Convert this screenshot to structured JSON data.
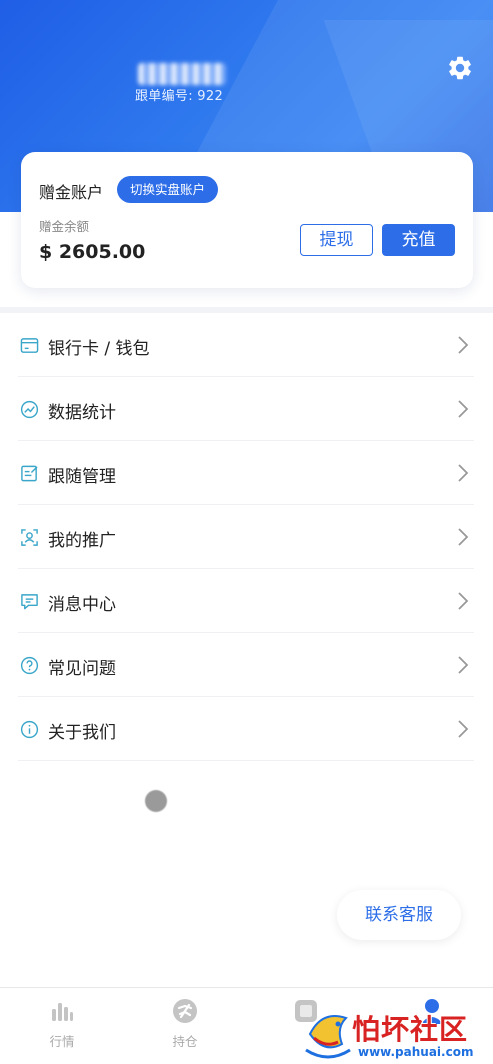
{
  "header": {
    "follow_number": "跟单编号: 922",
    "settings_icon": "gear-icon"
  },
  "account": {
    "title": "赠金账户",
    "switch_label": "切换实盘账户",
    "balance_label": "赠金余额",
    "balance_value": "$ 2605.00",
    "withdraw_label": "提现",
    "recharge_label": "充值"
  },
  "menu": [
    {
      "label": "银行卡 / 钱包",
      "icon": "wallet-icon"
    },
    {
      "label": "数据统计",
      "icon": "trend-chart-icon"
    },
    {
      "label": "跟随管理",
      "icon": "edit-list-icon"
    },
    {
      "label": "我的推广",
      "icon": "user-frame-icon"
    },
    {
      "label": "消息中心",
      "icon": "message-icon"
    },
    {
      "label": "常见问题",
      "icon": "question-icon"
    },
    {
      "label": "关于我们",
      "icon": "info-icon"
    }
  ],
  "service_button": "联系客服",
  "tabbar": [
    {
      "label": "行情",
      "icon": "bar-chart-icon"
    },
    {
      "label": "持仓",
      "icon": "position-icon"
    },
    {
      "label": "",
      "icon": "follow-icon"
    },
    {
      "label": "",
      "icon": "person-icon"
    }
  ],
  "watermark": {
    "title": "怕坏社区",
    "url": "www.pahuai.com"
  },
  "colors": {
    "primary": "#2d6ee8",
    "header_gradient_start": "#1f5ee6",
    "icon_teal": "#3aa6c9",
    "watermark_red": "#d92323"
  }
}
